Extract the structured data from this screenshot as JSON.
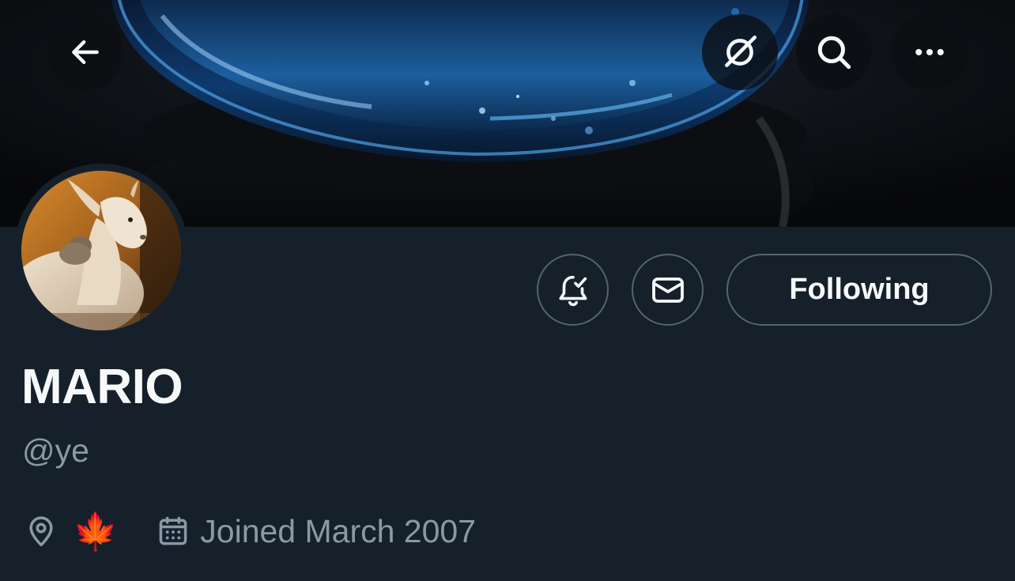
{
  "header": {
    "back_icon": "arrow-left-icon",
    "grok_icon": "grok-icon",
    "search_icon": "search-icon",
    "more_icon": "more-horizontal-icon"
  },
  "profile": {
    "display_name": "MARIO",
    "handle": "@ye",
    "location": "🍁",
    "location_icon": "location-pin-icon",
    "joined": "Joined March 2007",
    "joined_icon": "calendar-icon",
    "avatar_description": "goat-photo"
  },
  "actions": {
    "notifications_icon": "bell-check-icon",
    "message_icon": "envelope-icon",
    "following_label": "Following"
  },
  "colors": {
    "background": "#15202b",
    "primary_text": "#f7f9f9",
    "secondary_text": "#8b98a5",
    "button_border": "#566370"
  }
}
